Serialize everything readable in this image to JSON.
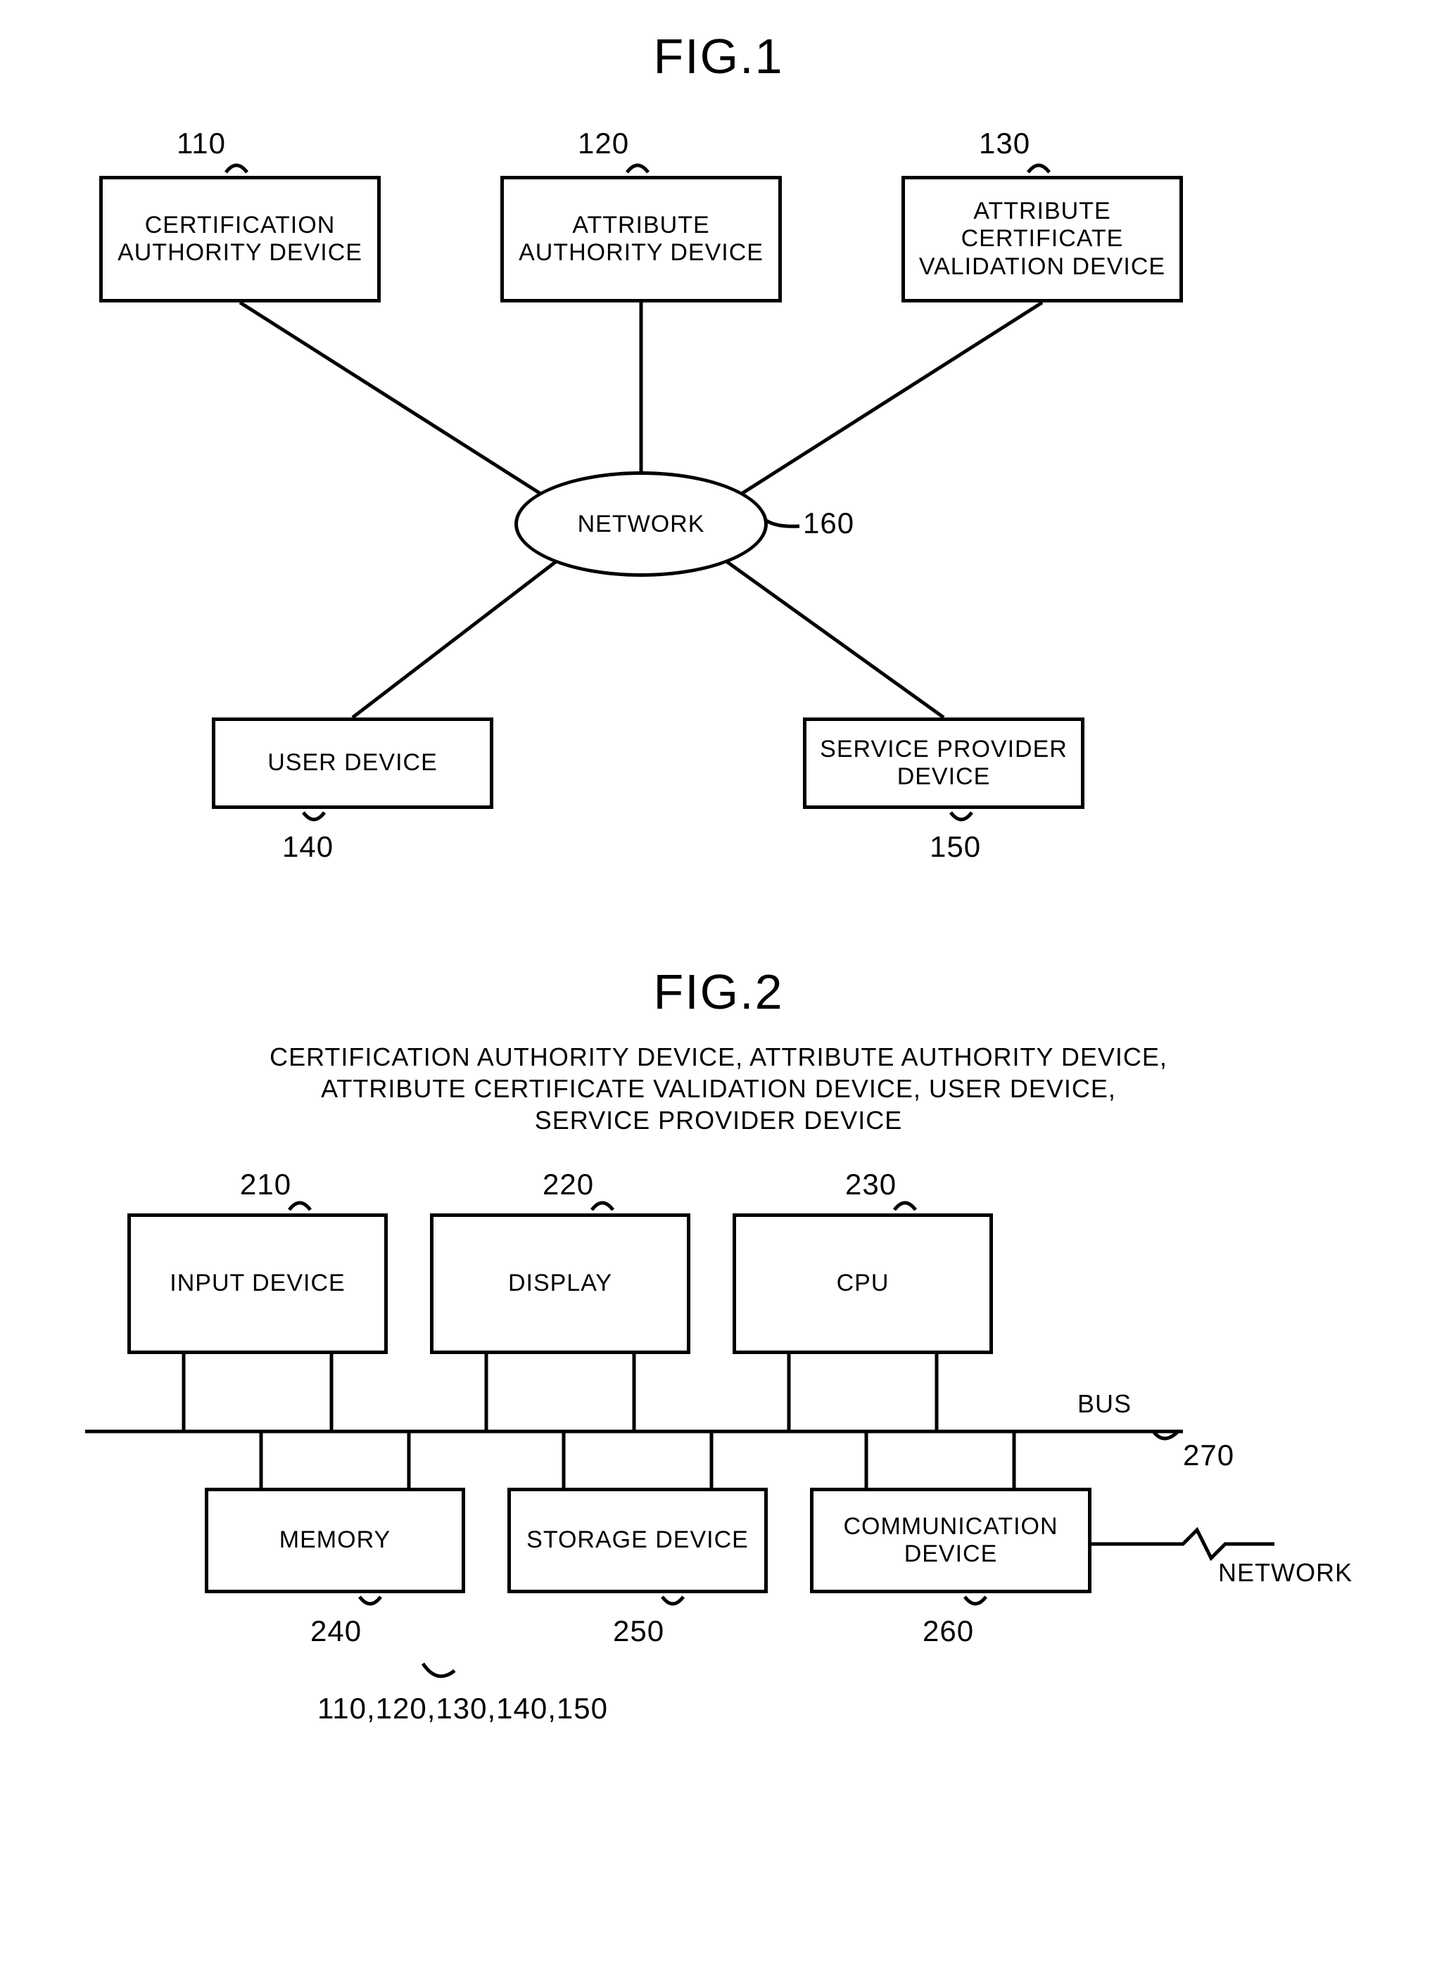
{
  "fig1": {
    "title": "FIG.1",
    "nodes": {
      "n110": {
        "ref": "110",
        "label": "CERTIFICATION AUTHORITY DEVICE"
      },
      "n120": {
        "ref": "120",
        "label": "ATTRIBUTE AUTHORITY DEVICE"
      },
      "n130": {
        "ref": "130",
        "label": "ATTRIBUTE CERTIFICATE VALIDATION DEVICE"
      },
      "n140": {
        "ref": "140",
        "label": "USER DEVICE"
      },
      "n150": {
        "ref": "150",
        "label": "SERVICE PROVIDER DEVICE"
      },
      "n160": {
        "ref": "160",
        "label": "NETWORK"
      }
    }
  },
  "fig2": {
    "title": "FIG.2",
    "caption_line1": "CERTIFICATION AUTHORITY DEVICE, ATTRIBUTE AUTHORITY DEVICE,",
    "caption_line2": "ATTRIBUTE CERTIFICATE VALIDATION DEVICE, USER DEVICE,",
    "caption_line3": "SERVICE PROVIDER DEVICE",
    "nodes": {
      "n210": {
        "ref": "210",
        "label": "INPUT DEVICE"
      },
      "n220": {
        "ref": "220",
        "label": "DISPLAY"
      },
      "n230": {
        "ref": "230",
        "label": "CPU"
      },
      "n240": {
        "ref": "240",
        "label": "MEMORY"
      },
      "n250": {
        "ref": "250",
        "label": "STORAGE DEVICE"
      },
      "n260": {
        "ref": "260",
        "label": "COMMUNICATION DEVICE"
      },
      "n270": {
        "ref": "270",
        "label": "BUS"
      }
    },
    "network_label": "NETWORK",
    "group_ref": "110,120,130,140,150"
  }
}
